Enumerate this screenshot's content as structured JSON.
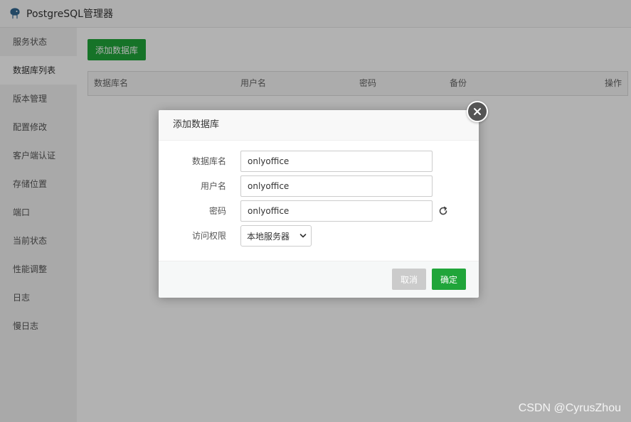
{
  "window": {
    "title": "PostgreSQL管理器"
  },
  "sidebar": {
    "items": [
      {
        "label": "服务状态"
      },
      {
        "label": "数据库列表"
      },
      {
        "label": "版本管理"
      },
      {
        "label": "配置修改"
      },
      {
        "label": "客户端认证"
      },
      {
        "label": "存储位置"
      },
      {
        "label": "端口"
      },
      {
        "label": "当前状态"
      },
      {
        "label": "性能调整"
      },
      {
        "label": "日志"
      },
      {
        "label": "慢日志"
      }
    ],
    "active_index": 1
  },
  "main": {
    "add_button_label": "添加数据库",
    "table": {
      "columns": [
        "数据库名",
        "用户名",
        "密码",
        "备份",
        "操作"
      ]
    }
  },
  "dialog": {
    "title": "添加数据库",
    "fields": {
      "db_name": {
        "label": "数据库名",
        "value": "onlyoffice"
      },
      "username": {
        "label": "用户名",
        "value": "onlyoffice"
      },
      "password": {
        "label": "密码",
        "value": "onlyoffice"
      },
      "access": {
        "label": "访问权限",
        "value": "本地服务器"
      }
    },
    "cancel_label": "取消",
    "ok_label": "确定"
  },
  "watermark": "CSDN @CyrusZhou",
  "colors": {
    "accent": "#20a53a",
    "sidebar_bg": "#f2f2f2",
    "cancel_bg": "#cbcbcb"
  }
}
